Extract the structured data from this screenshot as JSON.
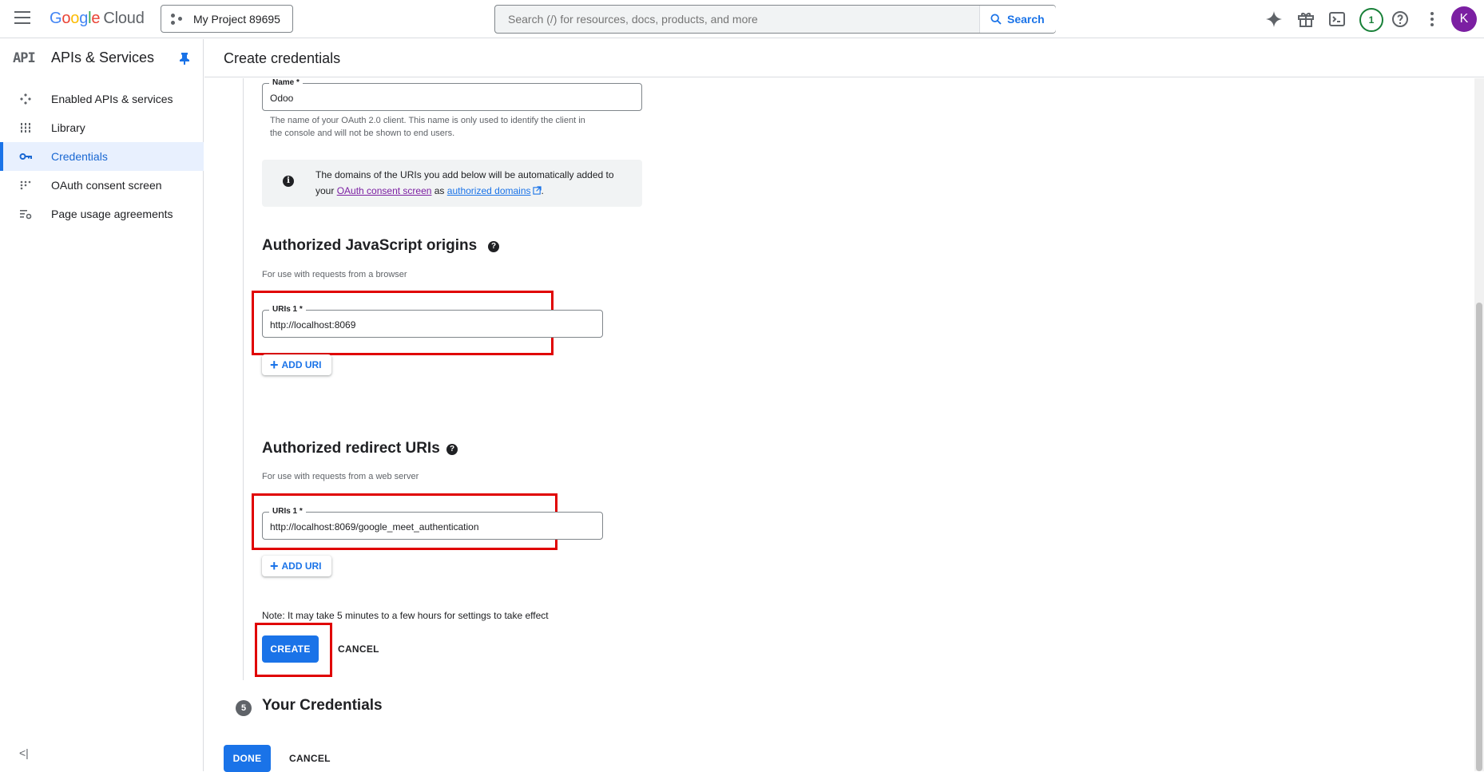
{
  "header": {
    "menu_icon": "hamburger-menu-icon",
    "logo": {
      "g": "G",
      "o1": "o",
      "o2": "o",
      "g2": "g",
      "l": "l",
      "e": "e",
      "cloud": "Cloud"
    },
    "project_name": "My Project 89695",
    "search_placeholder": "Search (/) for resources, docs, products, and more",
    "search_button": "Search",
    "icons": [
      "gemini-sparkle-icon",
      "gift-icon",
      "cloud-shell-terminal-icon",
      "help-icon",
      "more-vert-icon"
    ],
    "notification_count": "1",
    "avatar_letter": "K"
  },
  "sidebar": {
    "api_mark": "API",
    "title": "APIs & Services",
    "items": [
      {
        "label": "Enabled APIs & services",
        "icon": "apis-diamond-icon",
        "active": false
      },
      {
        "label": "Library",
        "icon": "library-grid-icon",
        "active": false
      },
      {
        "label": "Credentials",
        "icon": "key-icon",
        "active": true
      },
      {
        "label": "OAuth consent screen",
        "icon": "consent-dots-icon",
        "active": false
      },
      {
        "label": "Page usage agreements",
        "icon": "settings-list-icon",
        "active": false
      }
    ],
    "collapse_glyph": "<|"
  },
  "page": {
    "title": "Create credentials"
  },
  "form": {
    "name_label": "Name *",
    "name_value": "Odoo",
    "name_hint_1": "The name of your OAuth 2.0 client. This name is only used to identify the client in",
    "name_hint_2": "the console and will not be shown to end users.",
    "info": {
      "text_before": "The domains of the URIs you add below will be automatically added to your ",
      "link1": "OAuth consent screen",
      "middle": " as ",
      "link2": "authorized domains",
      "after": "."
    },
    "js_origins": {
      "title": "Authorized JavaScript origins",
      "subtitle": "For use with requests from a browser",
      "uri_label": "URIs 1 *",
      "uri_value": "http://localhost:8069",
      "add_label": "ADD URI"
    },
    "redirect": {
      "title": "Authorized redirect URIs",
      "subtitle": "For use with requests from a web server",
      "uri_label": "URIs 1 *",
      "uri_value": "http://localhost:8069/google_meet_authentication",
      "add_label": "ADD URI"
    },
    "note": "Note: It may take 5 minutes to a few hours for settings to take effect",
    "create_label": "CREATE",
    "cancel_label": "CANCEL"
  },
  "credentials_step": {
    "number": "5",
    "title": "Your Credentials"
  },
  "footer": {
    "done_label": "DONE",
    "cancel_label": "CANCEL"
  }
}
